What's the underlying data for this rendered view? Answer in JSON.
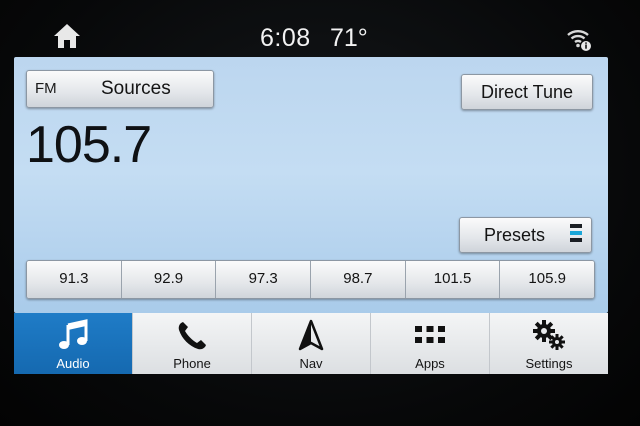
{
  "status": {
    "time": "6:08",
    "temperature": "71°",
    "icons": [
      "home-icon",
      "wifi-info-icon"
    ]
  },
  "radio": {
    "band": "FM",
    "sources_label": "Sources",
    "direct_tune_label": "Direct Tune",
    "frequency": "105.7",
    "presets_label": "Presets",
    "presets": [
      "91.3",
      "92.9",
      "97.3",
      "98.7",
      "101.5",
      "105.9"
    ]
  },
  "nav": {
    "items": [
      {
        "label": "Audio",
        "icon": "music-note-icon",
        "active": true
      },
      {
        "label": "Phone",
        "icon": "phone-icon",
        "active": false
      },
      {
        "label": "Nav",
        "icon": "navigation-arrow-icon",
        "active": false
      },
      {
        "label": "Apps",
        "icon": "apps-grid-icon",
        "active": false
      },
      {
        "label": "Settings",
        "icon": "gears-icon",
        "active": false
      }
    ]
  },
  "colors": {
    "screen_bg": "#bcd6ef",
    "active_tab": "#1f7cc7",
    "preset_indicator": "#1aa6d8"
  }
}
